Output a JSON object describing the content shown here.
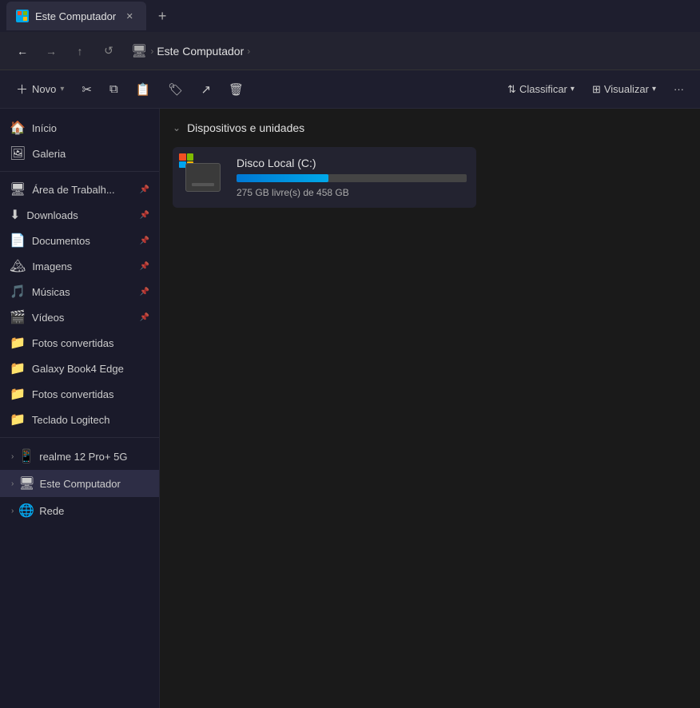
{
  "titlebar": {
    "tab_title": "Este Computador",
    "tab_close": "✕",
    "tab_add": "+"
  },
  "navbar": {
    "back_btn": "←",
    "forward_btn": "→",
    "up_btn": "↑",
    "refresh_btn": "↺",
    "monitor_icon": "🖥",
    "separator": "›",
    "address_text": "Este Computador",
    "address_chevron": "›"
  },
  "toolbar": {
    "new_label": "Novo",
    "classify_label": "Classificar",
    "view_label": "Visualizar",
    "more_label": "···"
  },
  "sidebar": {
    "inicio_label": "Início",
    "galeria_label": "Galeria",
    "area_trabalho_label": "Área de Trabalh...",
    "downloads_label": "Downloads",
    "documentos_label": "Documentos",
    "imagens_label": "Imagens",
    "musicas_label": "Músicas",
    "videos_label": "Vídeos",
    "fotos1_label": "Fotos convertidas",
    "galaxy_label": "Galaxy Book4 Edge",
    "fotos2_label": "Fotos convertidas",
    "teclado_label": "Teclado Logitech",
    "realme_label": "realme 12 Pro+ 5G",
    "este_computador_label": "Este Computador",
    "rede_label": "Rede"
  },
  "content": {
    "section_title": "Dispositivos e unidades",
    "drive_name": "Disco Local (C:)",
    "drive_space": "275 GB livre(s) de 458 GB",
    "drive_fill_percent": 40
  }
}
